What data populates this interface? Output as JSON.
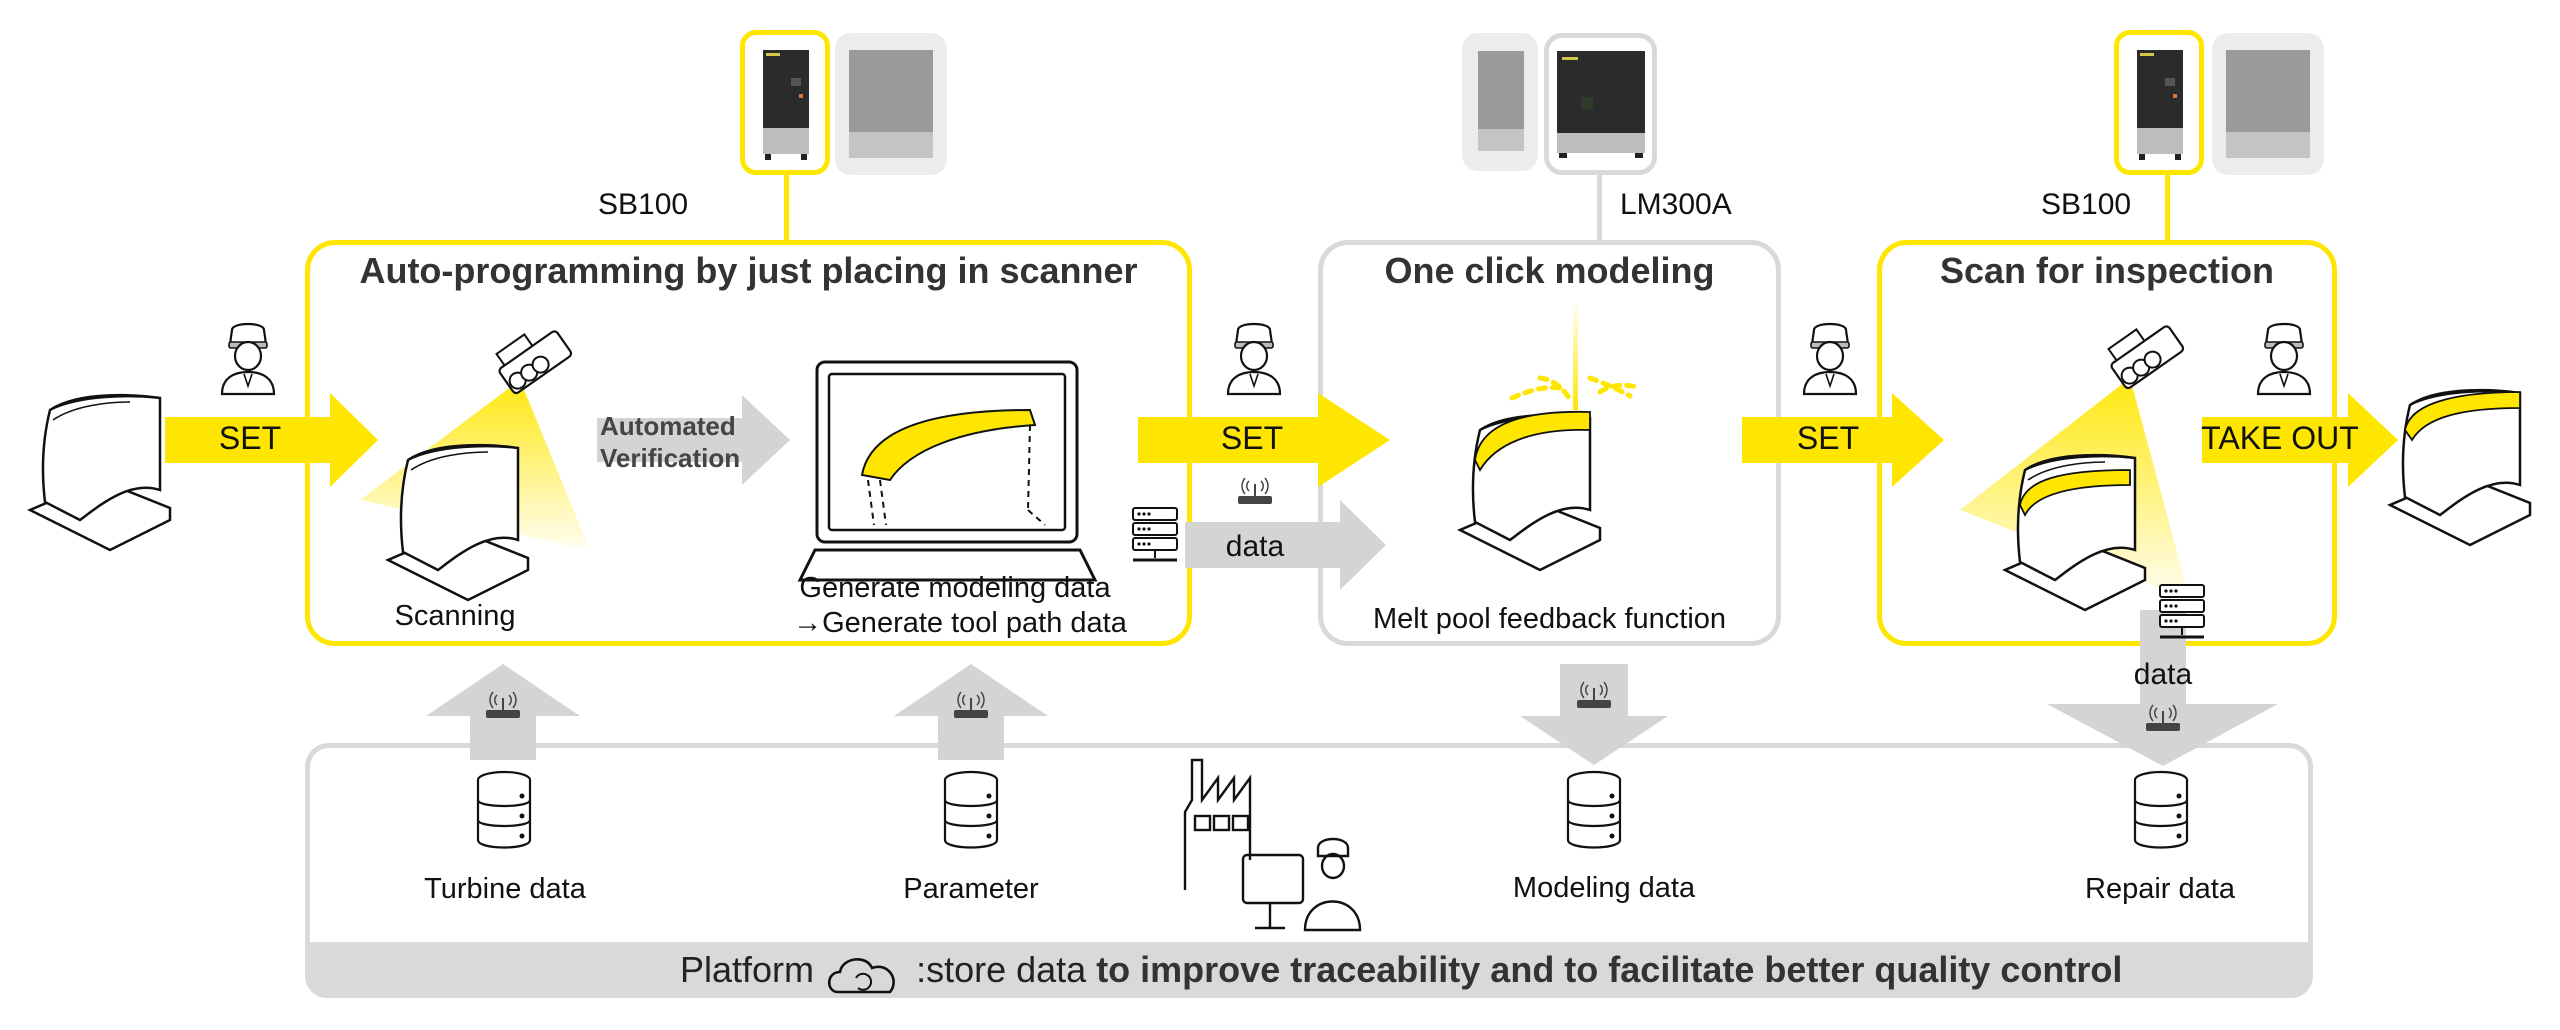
{
  "machines": [
    {
      "label": "SB100",
      "active": "SB100",
      "inactive": "LM300A"
    },
    {
      "label": "LM300A",
      "active": "LM300A",
      "inactive": "SB100"
    },
    {
      "label": "SB100",
      "active": "SB100",
      "inactive": "LM300A"
    }
  ],
  "stages": [
    {
      "title": "Auto-programming by just placing in scanner",
      "border_color": "#ffe600",
      "items": [
        {
          "label": "Scanning"
        },
        {
          "label": "Automated\nVerification",
          "line1": "Automated",
          "line2": "Verification"
        },
        {
          "line1": "Generate modeling data",
          "line2": "→Generate tool path data"
        }
      ]
    },
    {
      "title": "One click modeling",
      "border_color": "#d9d9d9",
      "items": [
        {
          "label": "Melt pool feedback function"
        }
      ]
    },
    {
      "title": "Scan for inspection",
      "border_color": "#ffe600",
      "items": []
    }
  ],
  "flow_arrows": [
    {
      "label": "SET"
    },
    {
      "label": "SET"
    },
    {
      "label": "SET"
    },
    {
      "label": "TAKE OUT"
    }
  ],
  "data_arrows": [
    {
      "label": "data",
      "direction": "right"
    },
    {
      "label": "data",
      "direction": "down"
    }
  ],
  "platform": {
    "databases": [
      {
        "label": "Turbine data",
        "arrow": "up"
      },
      {
        "label": "Parameter",
        "arrow": "up"
      },
      {
        "label": "Modeling data",
        "arrow": "down"
      },
      {
        "label": "Repair data",
        "arrow": "down"
      }
    ],
    "caption_prefix": "Platform",
    "caption_plain": ":store data ",
    "caption_bold": "to improve traceability and to facilitate better quality control"
  },
  "colors": {
    "accent_yellow": "#ffe600",
    "frame_gray": "#d9d9d9",
    "arrow_gray": "#d4d4d4",
    "machine_dark": "#2b2b2b"
  }
}
